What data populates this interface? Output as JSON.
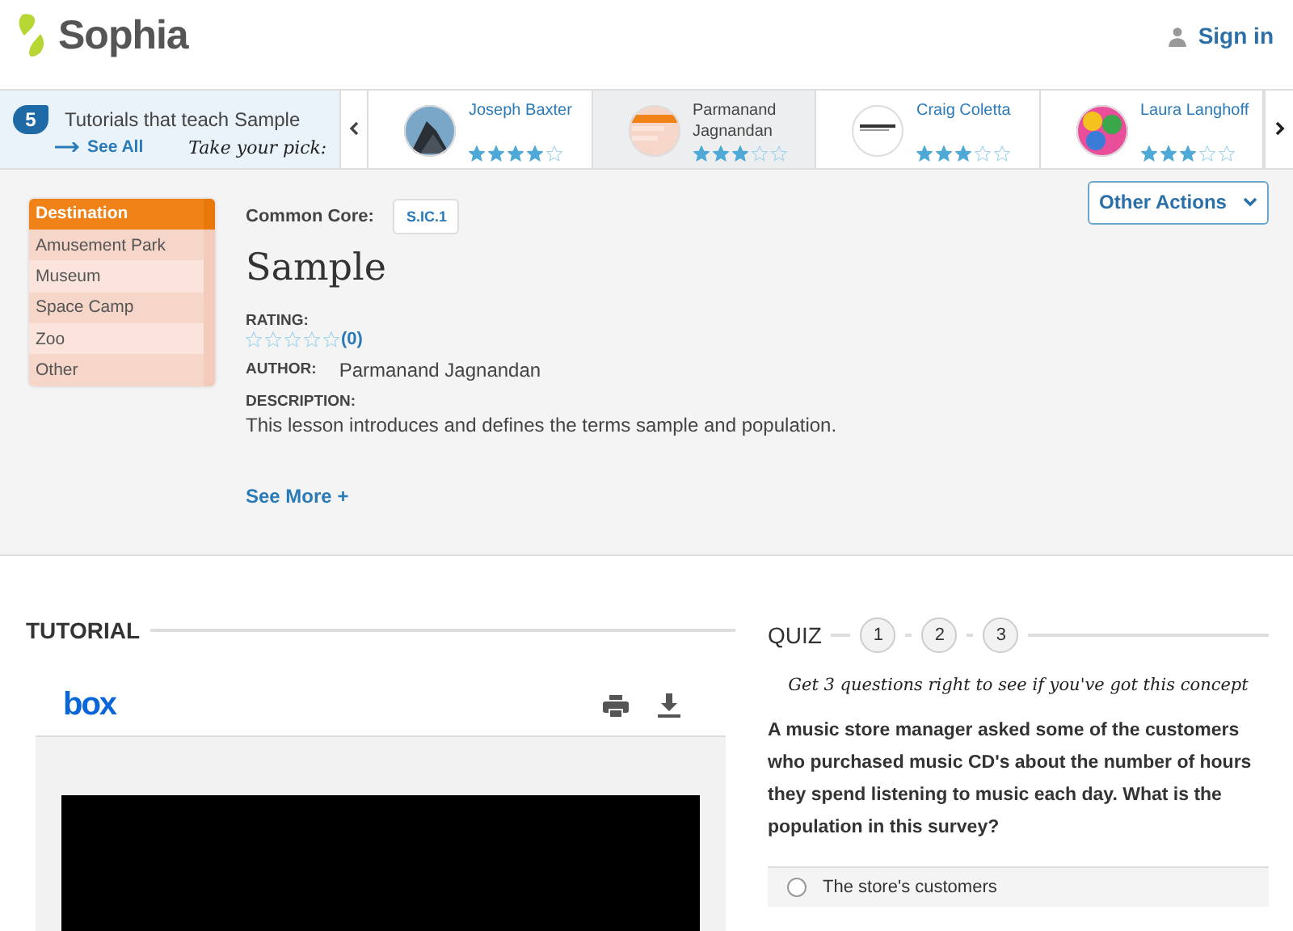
{
  "header": {
    "brand": "Sophia",
    "sign_in": "Sign in"
  },
  "carousel": {
    "count": "5",
    "title": "Tutorials that teach Sample",
    "see_all": "See All",
    "tagline": "Take your pick:",
    "cards": [
      {
        "name": "Joseph Baxter",
        "stars": 4,
        "selected": false
      },
      {
        "name": "Parmanand Jagnandan",
        "stars": 3,
        "selected": true
      },
      {
        "name": "Craig Coletta",
        "stars": 3,
        "selected": false
      },
      {
        "name": "Laura Langhoff",
        "stars": 3,
        "selected": false
      }
    ]
  },
  "destination_table": {
    "header": "Destination",
    "rows": [
      "Amusement Park",
      "Museum",
      "Space Camp",
      "Zoo",
      "Other"
    ]
  },
  "lesson": {
    "common_core_label": "Common Core:",
    "standard": "S.IC.1",
    "title": "Sample",
    "rating_label": "RATING:",
    "stars": 0,
    "rating_count": "(0)",
    "author_label": "AUTHOR:",
    "author": "Parmanand Jagnandan",
    "description_label": "DESCRIPTION:",
    "description": "This lesson introduces and defines the terms sample and population.",
    "see_more": "See More +",
    "other_actions": "Other Actions"
  },
  "tutorial": {
    "heading": "TUTORIAL",
    "viewer_logo": "box"
  },
  "quiz": {
    "heading": "QUIZ",
    "steps": [
      {
        "label": "1",
        "selected": false
      },
      {
        "label": "2",
        "selected": false
      },
      {
        "label": "3",
        "selected": false
      }
    ],
    "subtitle": "Get 3 questions right to see if you've got this concept",
    "question": "A music store manager asked some of the customers who purchased music CD's about the number of hours they spend listening to music each day. What is the population in this survey?",
    "answers": [
      {
        "text": "The store's customers",
        "selected": false
      }
    ]
  }
}
